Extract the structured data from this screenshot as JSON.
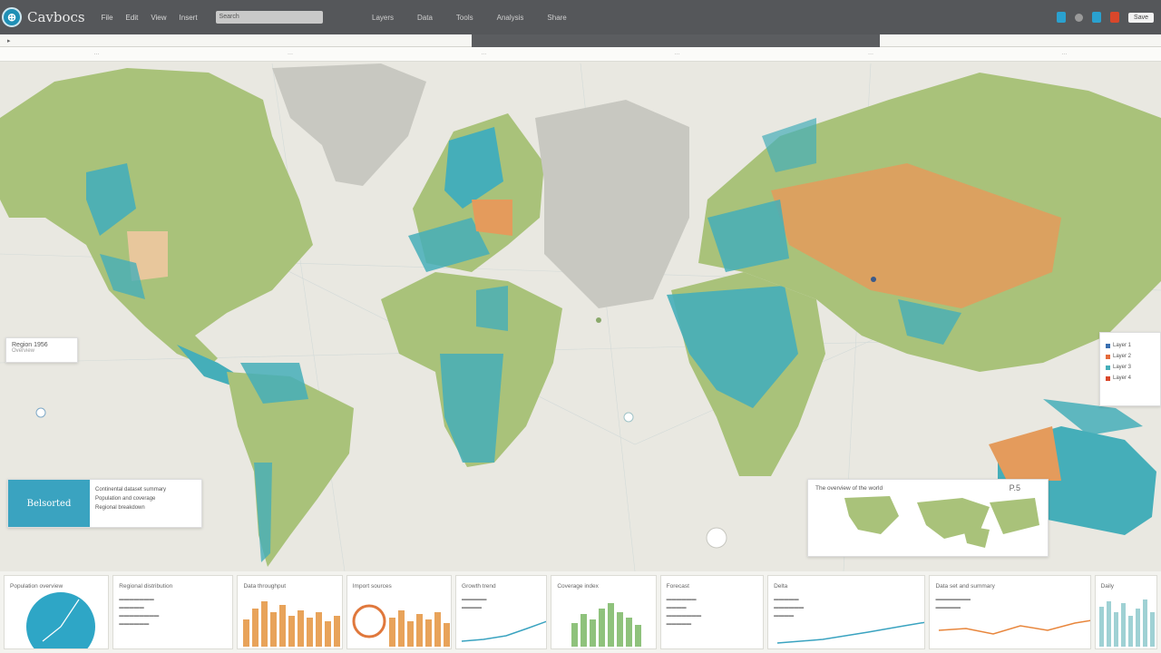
{
  "app": {
    "brand": "Cavbocs",
    "menu": [
      "File",
      "Edit",
      "View",
      "Insert"
    ],
    "search_placeholder": "Search",
    "actions": [
      "Layers",
      "Data",
      "Tools",
      "Analysis",
      "Share"
    ],
    "save_label": "Save"
  },
  "map": {
    "left_card_title": "Region 1956",
    "left_card_sub": "Overview",
    "feature_card_title": "Belsorted",
    "feature_card_lines": [
      "Continental dataset summary",
      "Population and coverage",
      "Regional breakdown"
    ],
    "mini_card_title": "The overview of the world",
    "mini_card_value": "P.5",
    "right_legend": [
      "Layer 1",
      "Layer 2",
      "Layer 3",
      "Layer 4"
    ]
  },
  "panels": [
    {
      "title": "Population overview"
    },
    {
      "title": "Regional distribution"
    },
    {
      "title": "Data throughput"
    },
    {
      "title": "Import sources"
    },
    {
      "title": "Growth trend"
    },
    {
      "title": "Coverage index"
    },
    {
      "title": "Forecast"
    },
    {
      "title": "Delta"
    },
    {
      "title": "Data set and summary"
    },
    {
      "title": "Daily"
    }
  ],
  "colors": {
    "land_green": "#a9c27a",
    "land_teal": "#45aeb9",
    "land_orange": "#e49b5c",
    "land_gray": "#c8c8c1",
    "ocean": "#e9e8e1"
  }
}
